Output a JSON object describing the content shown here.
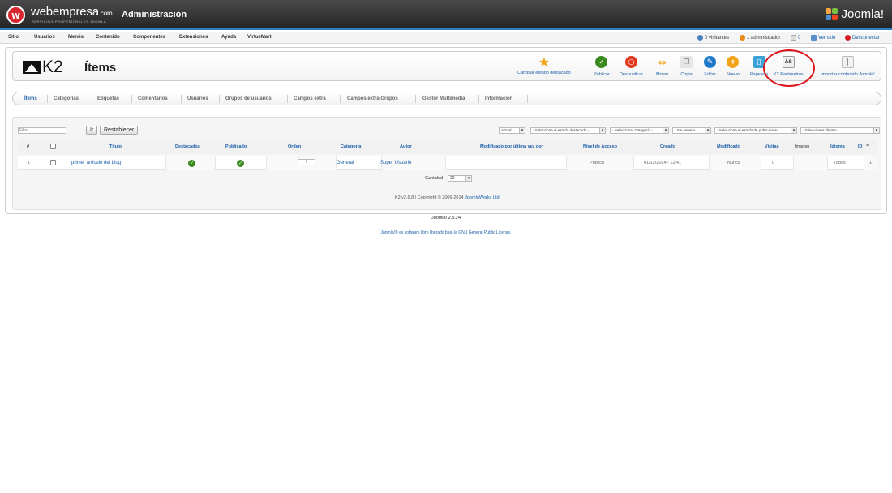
{
  "header": {
    "brand": "webempresa",
    "brand_suffix": ".com",
    "brand_tagline": "SERVICIOS PROFESIONALES JOOMLA",
    "admin_title": "Administración",
    "cms_name": "Joomla!"
  },
  "menu": {
    "items": [
      "Sitio",
      "Usuarios",
      "Menús",
      "Contenido",
      "Componentes",
      "Extensiones",
      "Ayuda",
      "VirtueMart"
    ]
  },
  "status": {
    "visitors": "0 visitantes",
    "admins": "1 administrador",
    "messages": "0",
    "view_site": "Ver sitio",
    "logout": "Desconectar"
  },
  "toolbar": {
    "component": "K2",
    "title": "Ítems",
    "buttons": [
      {
        "label": "Cambiar estado destacado",
        "icon": "star-icon",
        "color": "#f2a31a"
      },
      {
        "label": "Publicar",
        "icon": "publish-check-icon",
        "color": "#3a8a1e"
      },
      {
        "label": "Despublicar",
        "icon": "unpublish-icon",
        "color": "#e0391c"
      },
      {
        "label": "Mover",
        "icon": "move-arrows-icon",
        "color": "#f2a31a"
      },
      {
        "label": "Copia",
        "icon": "copy-icon",
        "color": "#c8c8c8"
      },
      {
        "label": "Editar",
        "icon": "edit-pencil-icon",
        "color": "#1e77c8"
      },
      {
        "label": "Nuevo",
        "icon": "new-plus-icon",
        "color": "#f2a31a"
      },
      {
        "label": "Papelera",
        "icon": "trash-icon",
        "color": "#3aa3d8"
      },
      {
        "label": "K2 Parámetros",
        "icon": "parameters-icon",
        "color": "#9a9a9a"
      },
      {
        "label": "Importar contenido Joomla!",
        "icon": "import-icon",
        "color": "#c8c8c8"
      }
    ]
  },
  "tabs": [
    "Ítems",
    "Categorías",
    "Etiquetas",
    "Comentarios",
    "Usuarios",
    "Grupos de usuarios",
    "Campos extra",
    "Campos extra Grupos",
    "Gestor Multimedia",
    "Información"
  ],
  "filters": {
    "search_placeholder": "Filtro",
    "go_label": "Ir",
    "reset_label": "Restablecer",
    "sort": "Actual",
    "featured": "- Selecciona el estado destacado -",
    "category": "- Seleccionar Categoría -",
    "user": "- Sin usuario -",
    "published": "- Selecciona el estado de publicación -",
    "language": "- Seleccionar idioma -"
  },
  "table": {
    "columns": [
      "#",
      "Título",
      "Destacados",
      "Publicado",
      "Orden",
      "Categoría",
      "Autor",
      "Modificado por última vez por",
      "Nivel de Acceso",
      "Creado",
      "Modificado",
      "Visitas",
      "Imagen",
      "Idioma",
      "ID"
    ],
    "rows": [
      {
        "num": "1",
        "title": "primer artículo del blog",
        "order": "1",
        "category": "General",
        "author": "Super Usuario",
        "modified_by": "",
        "access": "Público",
        "created": "01/12/2014 - 12:41",
        "modified": "Nunca",
        "hits": "0",
        "language": "Todos",
        "id": "1"
      }
    ],
    "quantity_label": "Cantidad",
    "quantity_value": "20"
  },
  "component_footer": {
    "version_text": "K2 v2.6.8 | Copyright © 2006-2014",
    "vendor": "JoomlaWorks Ltd."
  },
  "footer": {
    "version": "Joomla! 2.5.24",
    "license_prefix": "Joomla!® es software libre liberado bajo la",
    "license_link": "GNU General Public License."
  }
}
